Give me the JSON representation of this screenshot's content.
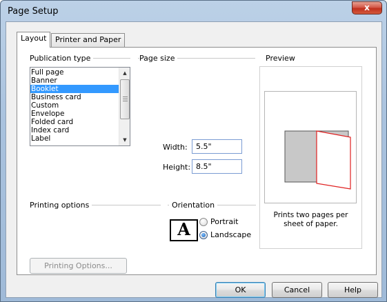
{
  "window": {
    "title": "Page Setup",
    "close_glyph": "x"
  },
  "tabs": [
    {
      "label": "Layout",
      "active": true
    },
    {
      "label": "Printer and Paper",
      "active": false
    }
  ],
  "publication_type": {
    "label": "Publication type",
    "items": [
      "Full page",
      "Banner",
      "Booklet",
      "Business card",
      "Custom",
      "Envelope",
      "Folded card",
      "Index card",
      "Label"
    ],
    "selected": "Booklet"
  },
  "page_size": {
    "label": "Page size",
    "width_label": "Width:",
    "width_value": "5.5\"",
    "height_label": "Height:",
    "height_value": "8.5\""
  },
  "preview": {
    "label": "Preview",
    "caption_line1": "Prints two pages per",
    "caption_line2": "sheet of paper."
  },
  "printing_options": {
    "label": "Printing options",
    "button_label": "Printing Options..."
  },
  "orientation": {
    "label": "Orientation",
    "icon_letter": "A",
    "portrait_label": "Portrait",
    "landscape_label": "Landscape",
    "selected": "Landscape"
  },
  "buttons": {
    "ok": "OK",
    "cancel": "Cancel",
    "help": "Help"
  },
  "colors": {
    "selection": "#3399ff",
    "preview_red": "#e02020",
    "preview_gray": "#c8c8c8"
  }
}
